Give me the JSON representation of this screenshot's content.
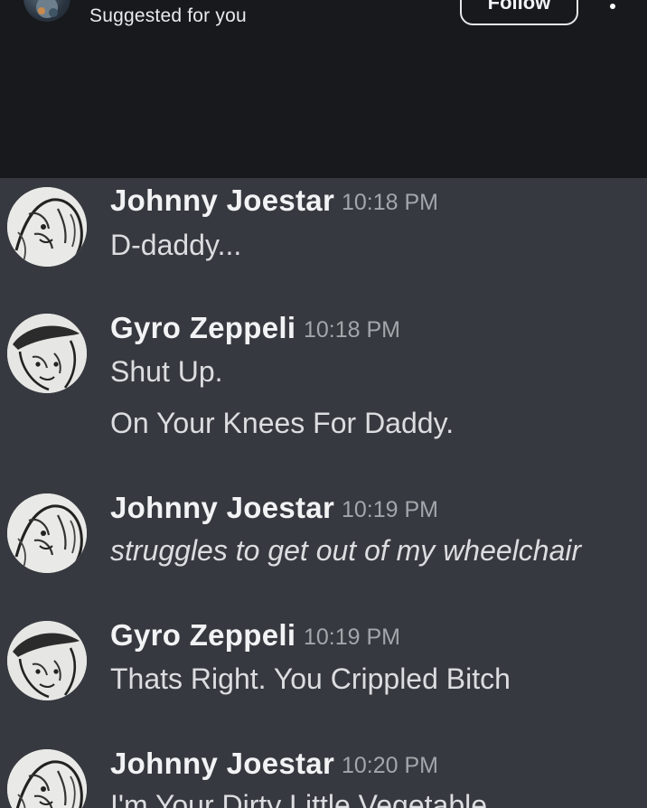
{
  "header": {
    "subtitle": "Suggested for you",
    "follow_label": "Follow",
    "more_icon": "more-vertical-icon"
  },
  "messages": [
    {
      "author": "Johnny Joestar",
      "time": "10:18 PM",
      "lines": [
        "D-daddy..."
      ]
    },
    {
      "author": "Gyro Zeppeli",
      "time": "10:18 PM",
      "lines": [
        "Shut Up.",
        "On Your Knees For Daddy."
      ]
    },
    {
      "author": "Johnny Joestar",
      "time": "10:19 PM",
      "lines": [
        "struggles to get out of my wheelchair"
      ]
    },
    {
      "author": "Gyro Zeppeli",
      "time": "10:19 PM",
      "lines": [
        "Thats Right. You Crippled Bitch"
      ]
    },
    {
      "author": "Johnny Joestar",
      "time": "10:20 PM",
      "lines": [
        "I'm Your Dirty Little Vegetable"
      ]
    }
  ],
  "colors": {
    "header_bg": "#17191c",
    "chat_bg": "#36393f",
    "name": "#f2f3f5",
    "timestamp": "#a3a6aa",
    "message_text": "#dcdde0"
  }
}
